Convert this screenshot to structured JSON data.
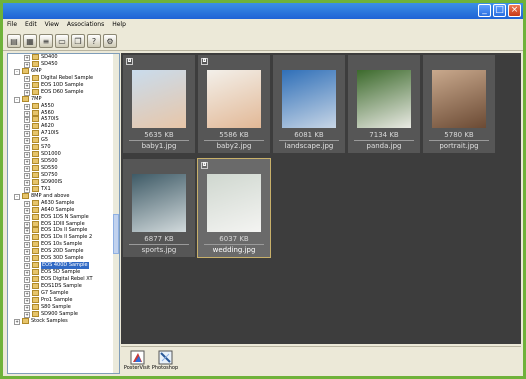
{
  "menu": [
    "File",
    "Edit",
    "View",
    "Associations",
    "Help"
  ],
  "tree": [
    {
      "label": "SD400",
      "level": 1,
      "exp": "+"
    },
    {
      "label": "SD450",
      "level": 1,
      "exp": "+"
    },
    {
      "label": "6MP",
      "level": 0,
      "exp": "-"
    },
    {
      "label": "Digital Rebel Sample",
      "level": 1,
      "exp": "+"
    },
    {
      "label": "EOS 10D Sample",
      "level": 1,
      "exp": "+"
    },
    {
      "label": "EOS D60 Sample",
      "level": 1,
      "exp": "+"
    },
    {
      "label": "7MP",
      "level": 0,
      "exp": "-"
    },
    {
      "label": "A550",
      "level": 1,
      "exp": "+"
    },
    {
      "label": "A560",
      "level": 1,
      "exp": "+"
    },
    {
      "label": "A570IS",
      "level": 1,
      "exp": "+"
    },
    {
      "label": "A620",
      "level": 1,
      "exp": "+"
    },
    {
      "label": "A710IS",
      "level": 1,
      "exp": "+"
    },
    {
      "label": "G5",
      "level": 1,
      "exp": "+"
    },
    {
      "label": "S70",
      "level": 1,
      "exp": "+"
    },
    {
      "label": "SD1000",
      "level": 1,
      "exp": "+"
    },
    {
      "label": "SD500",
      "level": 1,
      "exp": "+"
    },
    {
      "label": "SD550",
      "level": 1,
      "exp": "+"
    },
    {
      "label": "SD750",
      "level": 1,
      "exp": "+"
    },
    {
      "label": "SD900IS",
      "level": 1,
      "exp": "+"
    },
    {
      "label": "TX1",
      "level": 1,
      "exp": "+"
    },
    {
      "label": "8MP and above",
      "level": 0,
      "exp": "-"
    },
    {
      "label": "A630 Sample",
      "level": 1,
      "exp": "+"
    },
    {
      "label": "A640 Sample",
      "level": 1,
      "exp": "+"
    },
    {
      "label": "EOS 1DS N Sample",
      "level": 1,
      "exp": "+"
    },
    {
      "label": "EOS 1DIII Sample",
      "level": 1,
      "exp": "+"
    },
    {
      "label": "EOS 1Ds II Sample",
      "level": 1,
      "exp": "+"
    },
    {
      "label": "EOS 1Ds II Sample 2",
      "level": 1,
      "exp": "+"
    },
    {
      "label": "EOS 10s Sample",
      "level": 1,
      "exp": "+"
    },
    {
      "label": "EOS 20D Sample",
      "level": 1,
      "exp": "+"
    },
    {
      "label": "EOS 30D Sample",
      "level": 1,
      "exp": "+"
    },
    {
      "label": "EOS 400D Sample",
      "level": 1,
      "exp": "+",
      "selected": true
    },
    {
      "label": "EOS 5D Sample",
      "level": 1,
      "exp": "+"
    },
    {
      "label": "EOS Digital Rebel XT",
      "level": 1,
      "exp": "+"
    },
    {
      "label": "EOS1DS Sample",
      "level": 1,
      "exp": "+"
    },
    {
      "label": "G7 Sample",
      "level": 1,
      "exp": "+"
    },
    {
      "label": "Pro1 Sample",
      "level": 1,
      "exp": "+"
    },
    {
      "label": "S80 Sample",
      "level": 1,
      "exp": "+"
    },
    {
      "label": "SD900 Sample",
      "level": 1,
      "exp": "+"
    },
    {
      "label": "Stock Samples",
      "level": 0,
      "exp": "+"
    }
  ],
  "thumbs": [
    {
      "name": "baby1.jpg",
      "size": "5635 KB",
      "flag": true,
      "colors": [
        "#c9dced",
        "#e8c6a8"
      ]
    },
    {
      "name": "baby2.jpg",
      "size": "5586 KB",
      "flag": true,
      "colors": [
        "#f3f0ea",
        "#e2b896"
      ]
    },
    {
      "name": "landscape.jpg",
      "size": "6081 KB",
      "flag": false,
      "colors": [
        "#2f6fb8",
        "#c8d6e6"
      ]
    },
    {
      "name": "panda.jpg",
      "size": "7134 KB",
      "flag": false,
      "colors": [
        "#3c6a2c",
        "#eaeae4"
      ]
    },
    {
      "name": "portrait.jpg",
      "size": "5780 KB",
      "flag": false,
      "colors": [
        "#c9a98d",
        "#6b4a34"
      ]
    },
    {
      "name": "sports.jpg",
      "size": "6877 KB",
      "flag": false,
      "colors": [
        "#3e5a66",
        "#d2dadc"
      ]
    },
    {
      "name": "wedding.jpg",
      "size": "6037 KB",
      "flag": true,
      "selected": true,
      "colors": [
        "#cfd7cf",
        "#f4f4f2"
      ]
    }
  ],
  "apps": [
    {
      "label": "PosterVisit",
      "icon": "poster-icon"
    },
    {
      "label": "Photoshop",
      "icon": "photoshop-icon"
    }
  ]
}
